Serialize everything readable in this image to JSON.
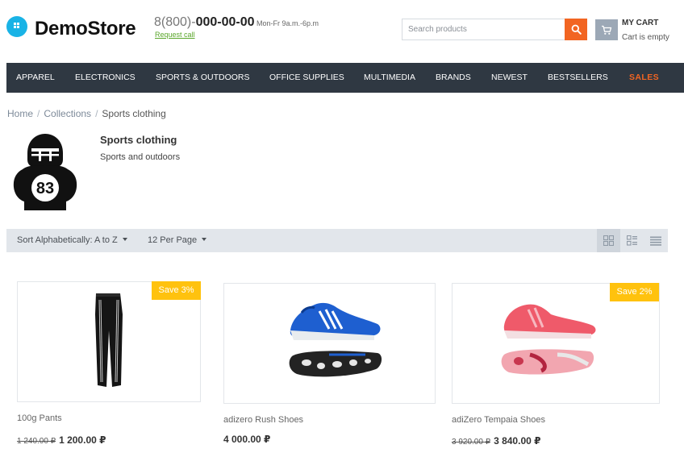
{
  "store": {
    "name": "DemoStore"
  },
  "contact": {
    "phone_prefix": "8(800)-",
    "phone_number": "000-00-00",
    "hours": "Mon-Fr 9a.m.-6p.m",
    "request_call": "Request call"
  },
  "search": {
    "placeholder": "Search products"
  },
  "cart": {
    "title": "MY CART",
    "status": "Cart is empty"
  },
  "nav": {
    "items": [
      "APPAREL",
      "ELECTRONICS",
      "SPORTS & OUTDOORS",
      "OFFICE SUPPLIES",
      "MULTIMEDIA",
      "BRANDS",
      "NEWEST",
      "BESTSELLERS",
      "SALES"
    ]
  },
  "breadcrumb": {
    "items": [
      "Home",
      "Collections",
      "Sports clothing"
    ],
    "separator": "/"
  },
  "collection": {
    "title": "Sports clothing",
    "description": "Sports and outdoors",
    "jersey_number": "83"
  },
  "toolbar": {
    "sort_label": "Sort Alphabetically: A to Z",
    "per_page_label": "12 Per Page"
  },
  "products": [
    {
      "name": "100g Pants",
      "old_price": "1 240.00 ₽",
      "price": "1 200.00 ₽",
      "badge": "Save 3%"
    },
    {
      "name": "adizero Rush Shoes",
      "old_price": "",
      "price": "4 000.00 ₽",
      "badge": ""
    },
    {
      "name": "adiZero Tempaia Shoes",
      "old_price": "3 920.00 ₽",
      "price": "3 840.00 ₽",
      "badge": "Save 2%"
    }
  ],
  "colors": {
    "accent": "#f26522",
    "logo_blue": "#19b3e6",
    "nav_bg": "#2f3842",
    "badge": "#ffc20e",
    "link_green": "#5aa62b"
  },
  "icons": {
    "logo": "store-logo-icon",
    "search": "search-icon",
    "cart": "cart-icon",
    "grid": "grid-view-icon",
    "list_grid": "list-grid-view-icon",
    "list": "list-view-icon"
  }
}
